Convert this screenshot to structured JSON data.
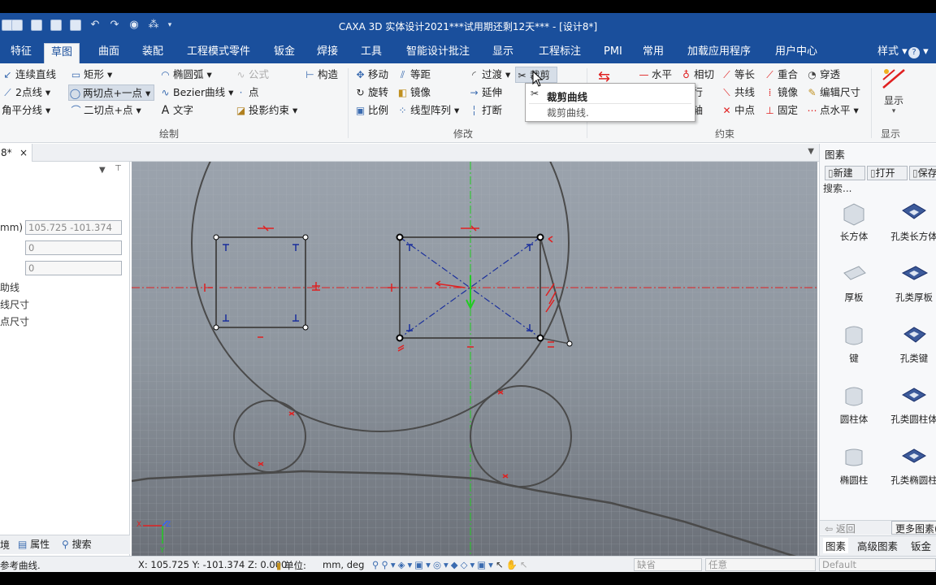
{
  "window": {
    "title": "CAXA 3D 实体设计2021***试用期还剩12天*** - [设计8*]"
  },
  "menu": {
    "tabs": [
      "特征",
      "草图",
      "曲面",
      "装配",
      "工程模式零件",
      "钣金",
      "焊接",
      "工具",
      "智能设计批注",
      "显示",
      "工程标注",
      "PMI",
      "常用",
      "加载应用程序",
      "用户中心"
    ],
    "active": "草图",
    "style_label": "样式",
    "help": "?"
  },
  "ribbon": {
    "draw": {
      "title": "绘制",
      "continuous_line": "连续直线",
      "two_point_line": "2点线",
      "angle_bisector": "角平分线",
      "rectangle": "矩形",
      "two_tangent_one_point": "两切点+一点",
      "two_tangent_point": "二切点+点",
      "ellipse_arc": "椭圆弧",
      "bezier": "Bezier曲线",
      "text": "文字",
      "formula": "公式",
      "point": "点",
      "projection_constraint": "投影约束",
      "construction": "构造"
    },
    "modify": {
      "title": "修改",
      "move": "移动",
      "rotate": "旋转",
      "scale": "比例",
      "offset": "等距",
      "mirror": "镜像",
      "linear_array": "线型阵列",
      "transition": "过渡",
      "extend": "延伸",
      "break": "打断",
      "trim": "裁剪"
    },
    "constraint": {
      "title": "约束",
      "horizontal": "水平",
      "parallel": "平行",
      "concentric": "同轴",
      "tangent": "相切",
      "collinear": "共线",
      "equal_length": "等长",
      "midpoint": "中点",
      "coincident": "重合",
      "mirror": "镜像",
      "fixed": "固定",
      "through": "穿透",
      "edit_dimension": "编辑尺寸",
      "point_horizontal": "点水平"
    },
    "display": {
      "title": "显示",
      "label": "显示"
    }
  },
  "tooltip": {
    "title": "裁剪曲线",
    "desc": "裁剪曲线."
  },
  "document": {
    "tab": "8*",
    "close": "×"
  },
  "left_panel": {
    "pin": "⊤",
    "field_label": "mm)",
    "field_value": "105.725 -101.374",
    "field2_value": "0",
    "field3_value": "0",
    "opt1": "助线",
    "opt2": "线尺寸",
    "opt3": "点尺寸",
    "tabs": [
      "境",
      "属性",
      "搜索"
    ]
  },
  "canvas": {
    "axis_x": "X",
    "axis_y": "Y",
    "axis_z": "Z"
  },
  "right_panel": {
    "title": "图素",
    "buttons": [
      "新建",
      "打开",
      "保存"
    ],
    "search": "搜索...",
    "items": [
      {
        "name": "长方体",
        "color": "#d7dde4"
      },
      {
        "name": "孔类长方体",
        "color": "#3c5a9a"
      },
      {
        "name": "厚板",
        "color": "#d7dde4"
      },
      {
        "name": "孔类厚板",
        "color": "#3c5a9a"
      },
      {
        "name": "键",
        "color": "#d7dde4"
      },
      {
        "name": "孔类键",
        "color": "#3c5a9a"
      },
      {
        "name": "圆柱体",
        "color": "#d7dde4"
      },
      {
        "name": "孔类圆柱体",
        "color": "#3c5a9a"
      },
      {
        "name": "椭圆柱",
        "color": "#d7dde4"
      },
      {
        "name": "孔类椭圆柱",
        "color": "#3c5a9a"
      }
    ],
    "back": "返回",
    "more": "更多图素(",
    "bottom_tabs": [
      "图素",
      "高级图素",
      "钣金"
    ]
  },
  "status": {
    "message": "参考曲线.",
    "coords": "X: 105.725 Y: -101.374 Z: 0.000",
    "units_label": "单位:",
    "units": "mm, deg",
    "default1": "缺省",
    "default2": "任意",
    "default3": "Default"
  },
  "colors": {
    "titlebar": "#1a4f9c",
    "sketch_line": "#4a4a4a",
    "constraint_red": "#e02020",
    "axis_green": "#22cc22",
    "dash_blue": "#1a2f9c"
  }
}
